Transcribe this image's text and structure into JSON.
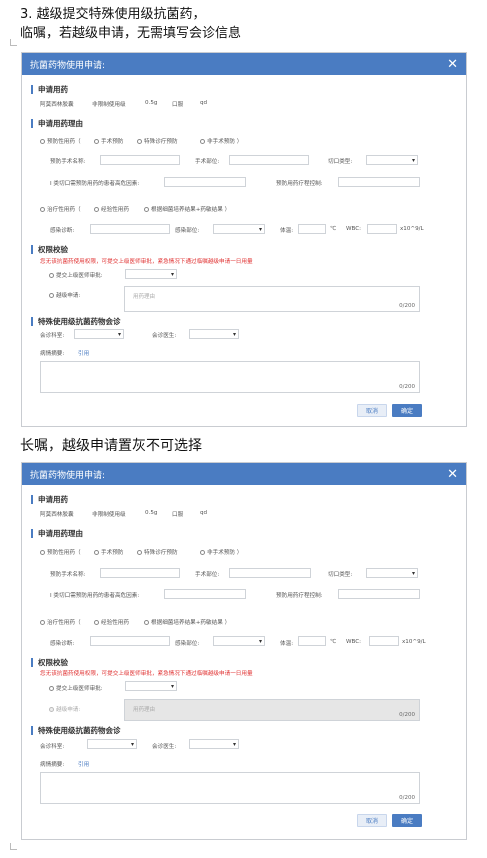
{
  "doc": {
    "line1": "3.   越级提交特殊使用级抗菌药，",
    "line2": "临嘱，若越级申请，无需填写会诊信息",
    "caption2": "长嘱，越级申请置灰不可选择"
  },
  "dialog": {
    "title": "抗菌药物使用申请:",
    "close_icon": "close-icon",
    "sec_drug": "申请用药",
    "drug": {
      "name": "阿莫西林胶囊",
      "level": "非限制使用级",
      "dose": "0.5g",
      "route": "口服",
      "freq": "qd"
    },
    "sec_reason": "申请用药理由",
    "prevent": {
      "label": "预防性用药（",
      "opt1": "手术预防",
      "opt2": "特殊诊疗预防",
      "opt3": "非手术预防 ）",
      "surgery_name": "预防手术名称:",
      "surgery_site": "手术部位:",
      "incision_type": "切口类型:",
      "risk_factor": "I 类切口需预防用药的患者高危因素:",
      "control": "预防用药疗程控制:"
    },
    "treat": {
      "label": "治疗性用药（",
      "opt1": "经验性用药",
      "opt2": "根据细菌培养结果+药敏结果 ）",
      "diagnosis": "感染诊断:",
      "site": "感染部位:",
      "temp": "体温:",
      "temp_unit": "℃",
      "wbc": "WBC:",
      "wbc_unit": "x10^9/L"
    },
    "sec_auth": "权限校验",
    "auth_warning": "您无该抗菌药使用权限，可提交上级医师审批，紧急情况下通过临嘱越级申请一日用量",
    "submit_upper": "提交上级医师审批:",
    "skip_apply": "越级申请:",
    "skip_placeholder": "用药理由",
    "skip_count": "0/200",
    "sec_consult": "特殊使用级抗菌药物会诊",
    "consult_dept": "会诊科室:",
    "consult_doctor": "会诊医生:",
    "history": "病情摘要:",
    "cite": "引用",
    "history_count": "0/200",
    "cancel": "取消",
    "ok": "确定"
  },
  "colors": {
    "accent": "#4a7cc2",
    "warning": "#e03030",
    "disabled": "#e6e6e6"
  }
}
